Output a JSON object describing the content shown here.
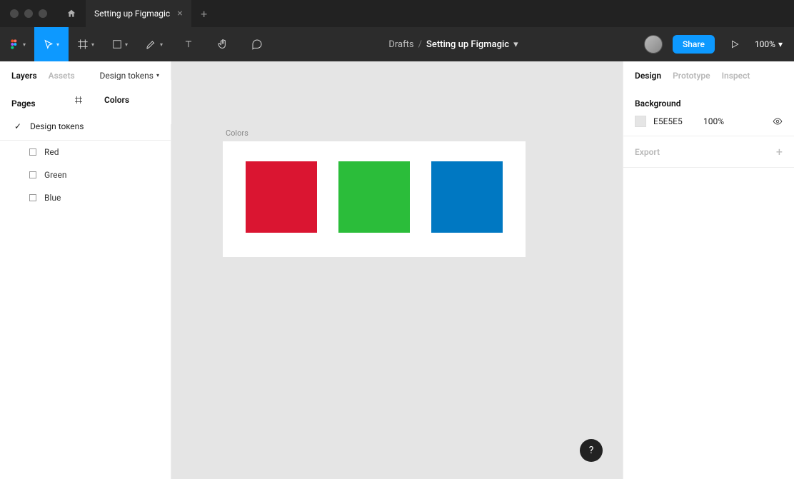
{
  "titlebar": {
    "tab_title": "Setting up Figmagic"
  },
  "toolbar": {
    "breadcrumb_root": "Drafts",
    "breadcrumb_title": "Setting up Figmagic",
    "share_label": "Share",
    "zoom_label": "100%"
  },
  "left_panel": {
    "tab_layers": "Layers",
    "tab_assets": "Assets",
    "tab_tokens": "Design tokens",
    "pages_header": "Pages",
    "page_current": "Design tokens",
    "frame_name": "Colors",
    "layers": [
      {
        "name": "Red"
      },
      {
        "name": "Green"
      },
      {
        "name": "Blue"
      }
    ]
  },
  "canvas": {
    "frame_label": "Colors",
    "swatches": [
      {
        "color": "#DA1531"
      },
      {
        "color": "#2BBD3A"
      },
      {
        "color": "#0078C2"
      }
    ]
  },
  "right_panel": {
    "tab_design": "Design",
    "tab_prototype": "Prototype",
    "tab_inspect": "Inspect",
    "background_title": "Background",
    "background_hex": "E5E5E5",
    "background_opacity": "100%",
    "export_title": "Export"
  },
  "help_label": "?"
}
